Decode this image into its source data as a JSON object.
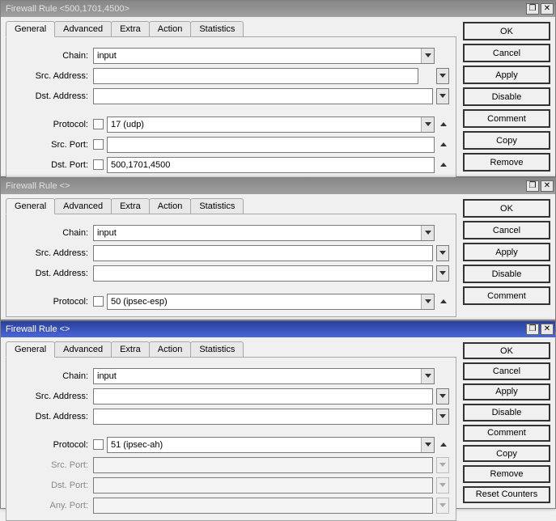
{
  "windows": [
    {
      "title": "Firewall Rule <500,1701,4500>",
      "tabs": [
        "General",
        "Advanced",
        "Extra",
        "Action",
        "Statistics"
      ],
      "activeTab": "General",
      "fields": {
        "chain_label": "Chain:",
        "chain_value": "input",
        "src_address_label": "Src. Address:",
        "src_address_value": "",
        "dst_address_label": "Dst. Address:",
        "dst_address_value": "",
        "protocol_label": "Protocol:",
        "protocol_value": "17 (udp)",
        "src_port_label": "Src. Port:",
        "src_port_value": "",
        "dst_port_label": "Dst. Port:",
        "dst_port_value": "500,1701,4500"
      },
      "buttons": [
        "OK",
        "Cancel",
        "Apply",
        "Disable",
        "Comment",
        "Copy",
        "Remove"
      ]
    },
    {
      "title": "Firewall Rule <>",
      "tabs": [
        "General",
        "Advanced",
        "Extra",
        "Action",
        "Statistics"
      ],
      "activeTab": "General",
      "fields": {
        "chain_label": "Chain:",
        "chain_value": "input",
        "src_address_label": "Src. Address:",
        "src_address_value": "",
        "dst_address_label": "Dst. Address:",
        "dst_address_value": "",
        "protocol_label": "Protocol:",
        "protocol_value": "50 (ipsec-esp)"
      },
      "buttons": [
        "OK",
        "Cancel",
        "Apply",
        "Disable",
        "Comment"
      ]
    },
    {
      "title": "Firewall Rule <>",
      "tabs": [
        "General",
        "Advanced",
        "Extra",
        "Action",
        "Statistics"
      ],
      "activeTab": "General",
      "fields": {
        "chain_label": "Chain:",
        "chain_value": "input",
        "src_address_label": "Src. Address:",
        "src_address_value": "",
        "dst_address_label": "Dst. Address:",
        "dst_address_value": "",
        "protocol_label": "Protocol:",
        "protocol_value": "51 (ipsec-ah)",
        "src_port_label": "Src. Port:",
        "src_port_value": "",
        "dst_port_label": "Dst. Port:",
        "dst_port_value": "",
        "any_port_label": "Any. Port:",
        "any_port_value": ""
      },
      "buttons": [
        "OK",
        "Cancel",
        "Apply",
        "Disable",
        "Comment",
        "Copy",
        "Remove",
        "Reset Counters"
      ]
    }
  ]
}
